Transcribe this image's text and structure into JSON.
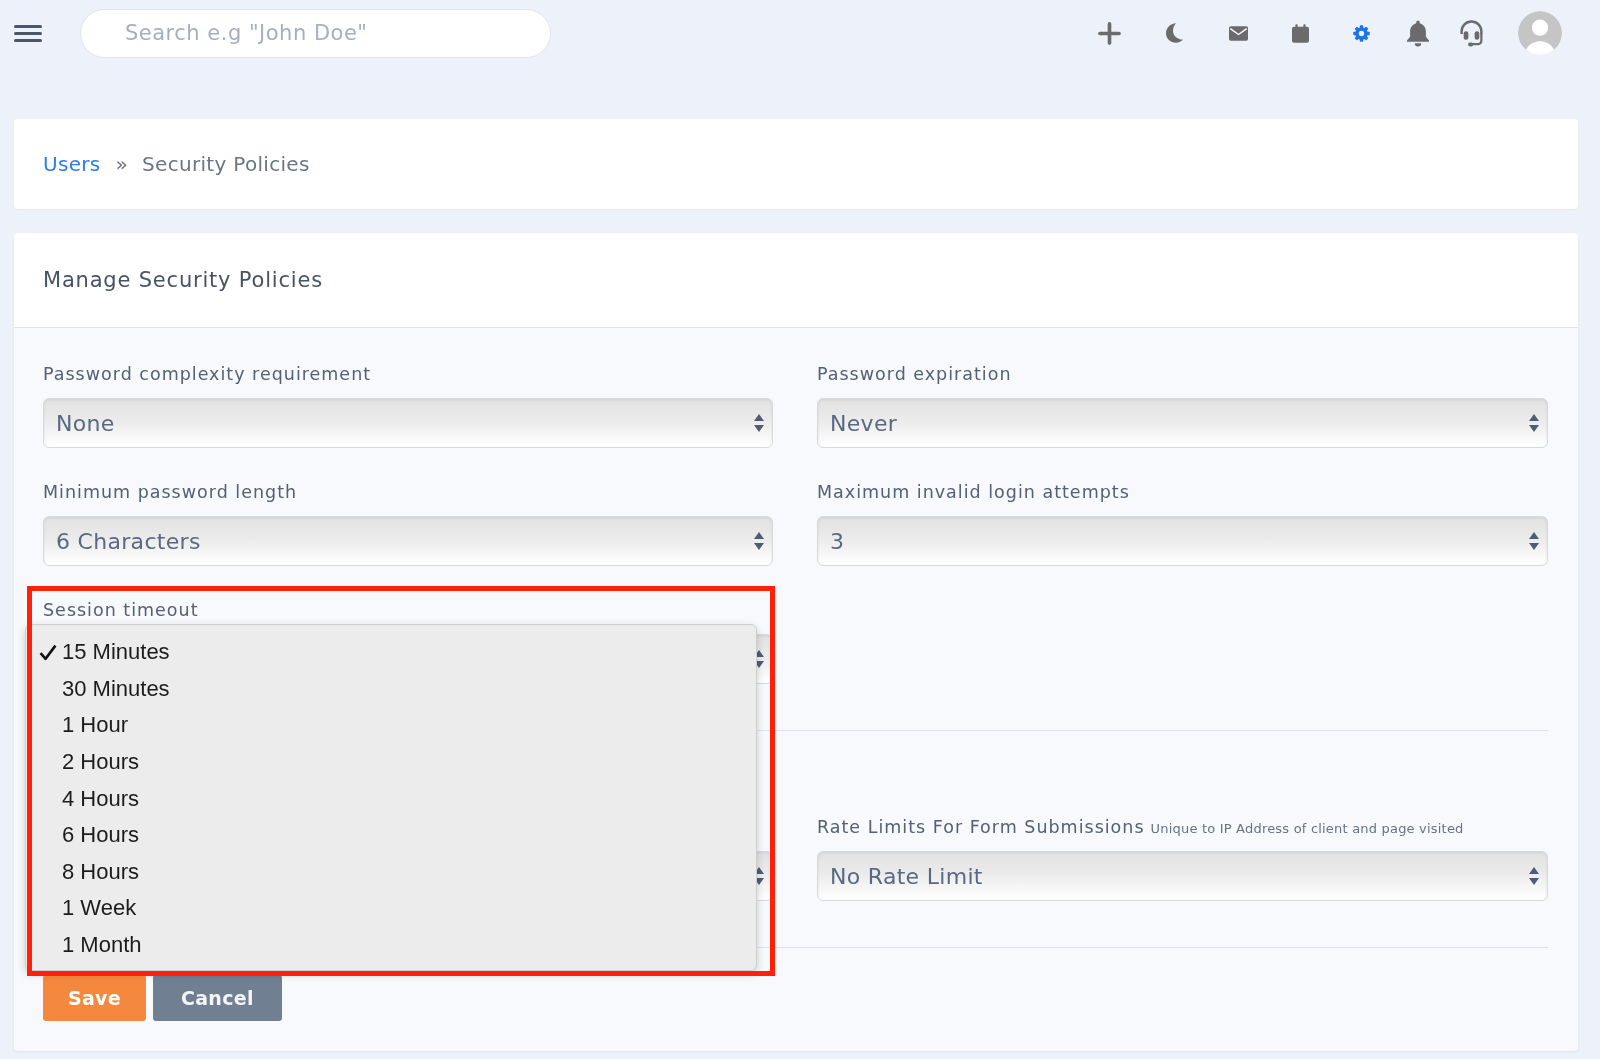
{
  "topbar": {
    "search": {
      "placeholder": "Search e.g \"John Doe\""
    },
    "toolbar": [
      {
        "kind": "add",
        "selected": false
      },
      {
        "kind": "theme",
        "selected": false
      },
      {
        "kind": "messages",
        "selected": false
      },
      {
        "kind": "calendar",
        "selected": false
      },
      {
        "kind": "settings",
        "selected": true
      },
      {
        "kind": "notifications",
        "selected": false
      },
      {
        "kind": "support",
        "selected": false
      }
    ]
  },
  "breadcrumb": {
    "items": [
      {
        "label": "Users",
        "kind": "link"
      },
      {
        "label": "Security Policies",
        "kind": "current"
      }
    ],
    "separator": "»"
  },
  "card": {
    "title": "Manage Security Policies",
    "sections": [
      {
        "fields": [
          {
            "kind": "select",
            "label": "Password complexity requirement",
            "value": "None"
          },
          {
            "kind": "select",
            "label": "Password expiration",
            "value": "Never"
          },
          {
            "kind": "select",
            "label": "Minimum password length",
            "value": "6 Characters"
          },
          {
            "kind": "select",
            "label": "Maximum invalid login attempts",
            "value": "3"
          },
          {
            "kind": "select",
            "label": "Session timeout",
            "highlighted": true,
            "expanded": true,
            "options": [
              {
                "label": "15 Minutes",
                "selected": true
              },
              {
                "label": "30 Minutes",
                "selected": false
              },
              {
                "label": "1 Hour",
                "selected": false
              },
              {
                "label": "2 Hours",
                "selected": false
              },
              {
                "label": "4 Hours",
                "selected": false
              },
              {
                "label": "6 Hours",
                "selected": false
              },
              {
                "label": "8 Hours",
                "selected": false
              },
              {
                "label": "1 Week",
                "selected": false
              },
              {
                "label": "1 Month",
                "selected": false
              }
            ]
          }
        ]
      },
      {
        "fields": [
          {
            "kind": "select"
          },
          {
            "kind": "select",
            "label": "Rate Limits For Form Submissions",
            "hint": "Unique to IP Address of client and page visited",
            "value": "No Rate Limit"
          }
        ]
      }
    ],
    "buttons": [
      {
        "label": "Save",
        "kind": "save"
      },
      {
        "label": "Cancel",
        "kind": "cancel"
      }
    ]
  }
}
